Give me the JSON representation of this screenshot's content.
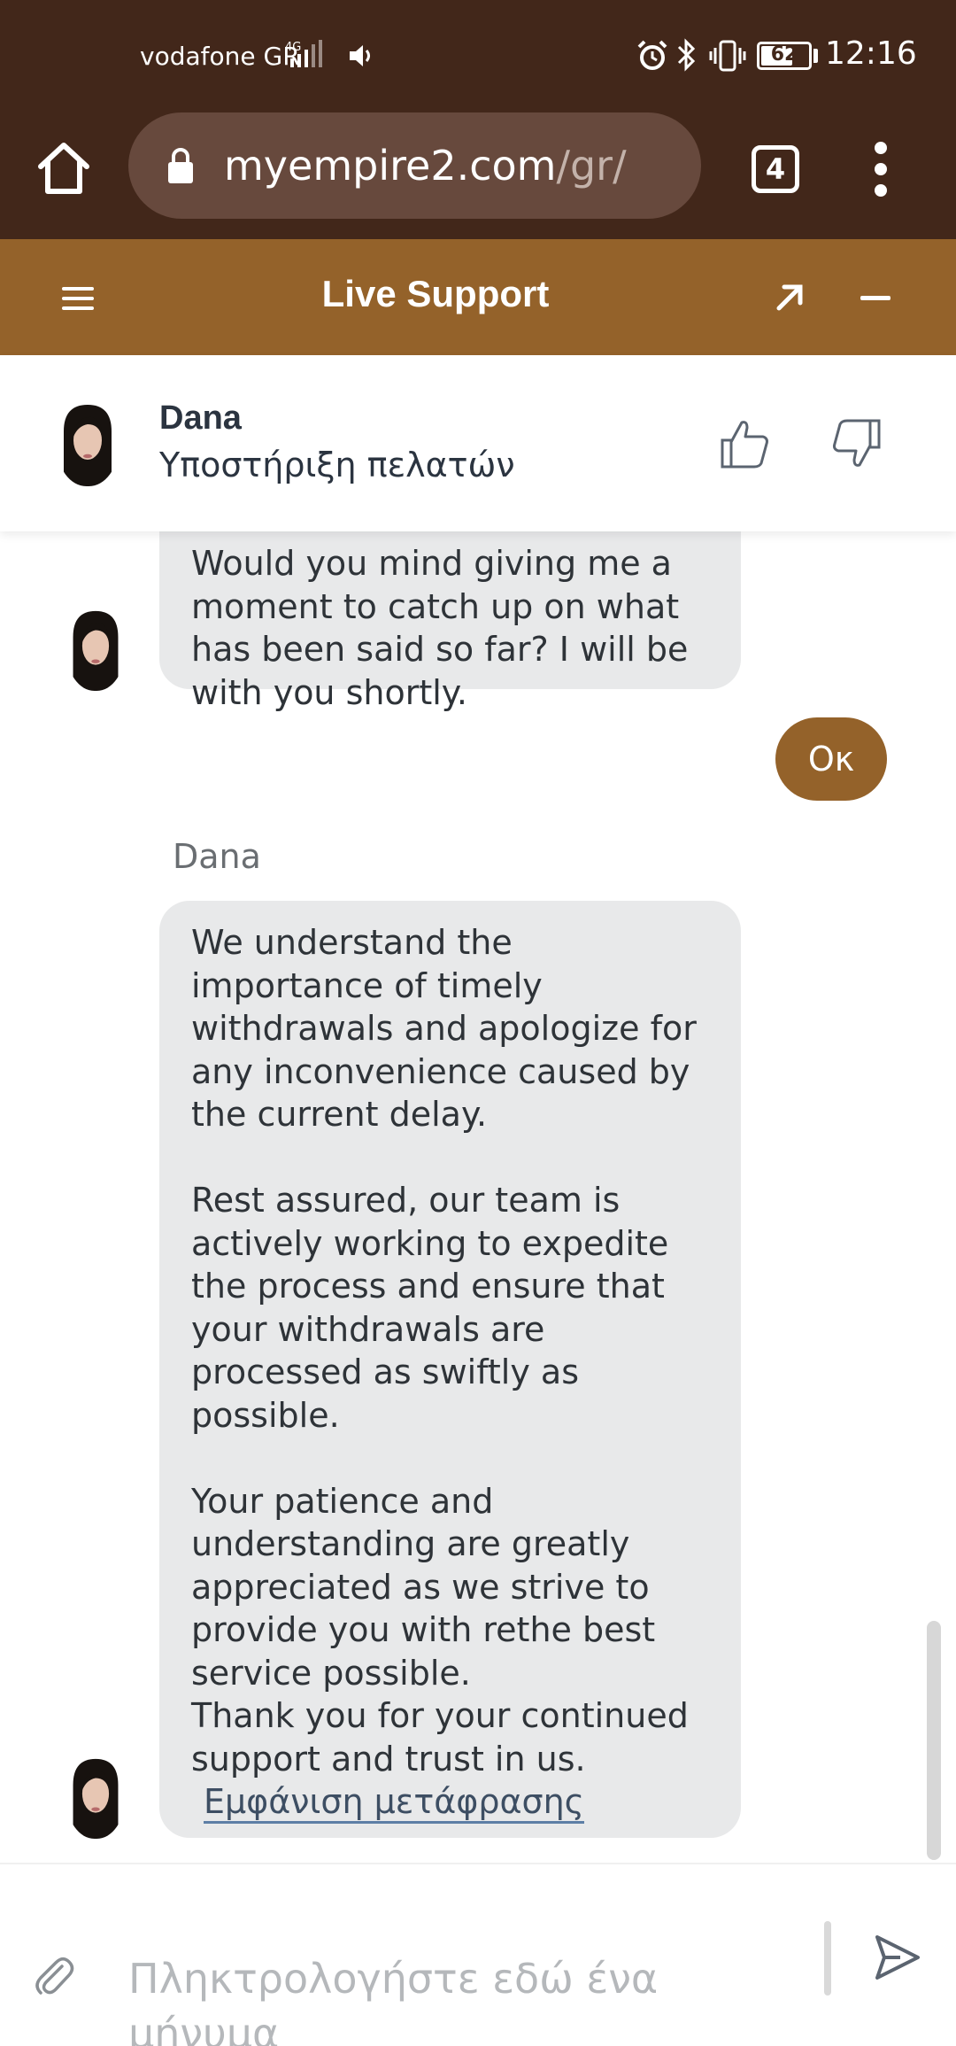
{
  "status_bar": {
    "carrier": "vodafone GR",
    "network": "4G",
    "battery": "62",
    "time": "12:16"
  },
  "browser": {
    "url_host": "myempire2.com",
    "url_path": "/gr/",
    "tab_count": "4"
  },
  "support_header": {
    "title": "Live Support"
  },
  "agent": {
    "name": "Dana",
    "role": "Υποστήριξη πελατών"
  },
  "chat": {
    "messages": [
      {
        "sender": "agent",
        "text": "Would you mind giving me a moment to catch up on what has been said so far? I will be with you shortly."
      },
      {
        "sender": "user",
        "text": "Οκ"
      },
      {
        "sender": "agent",
        "sender_label": "Dana",
        "text": "We understand the\nimportance of timely\nwithdrawals and apologize for\nany inconvenience caused by\nthe current delay.\n\nRest assured, our team is\nactively working to expedite\nthe process and ensure that\nyour withdrawals are\nprocessed as swiftly as\npossible.\n\nYour patience and\nunderstanding are greatly\nappreciated as we strive to\nprovide you with rethe best\nservice possible.\nThank you for your continued\nsupport and trust in us.",
        "translate_link": "Εμφάνιση μετάφρασης"
      }
    ]
  },
  "composer": {
    "placeholder": "Πληκτρολογήστε εδώ ένα μήνυμα"
  },
  "colors": {
    "status_bar_bg": "#42271a",
    "accent": "#94622a",
    "bubble_bg": "#e8e9ea"
  },
  "icons": [
    "home-icon",
    "lock-icon",
    "tabs-icon",
    "more-vert-icon",
    "hamburger-icon",
    "popout-icon",
    "minimize-icon",
    "thumbs-up-icon",
    "thumbs-down-icon",
    "attach-icon",
    "send-icon"
  ]
}
